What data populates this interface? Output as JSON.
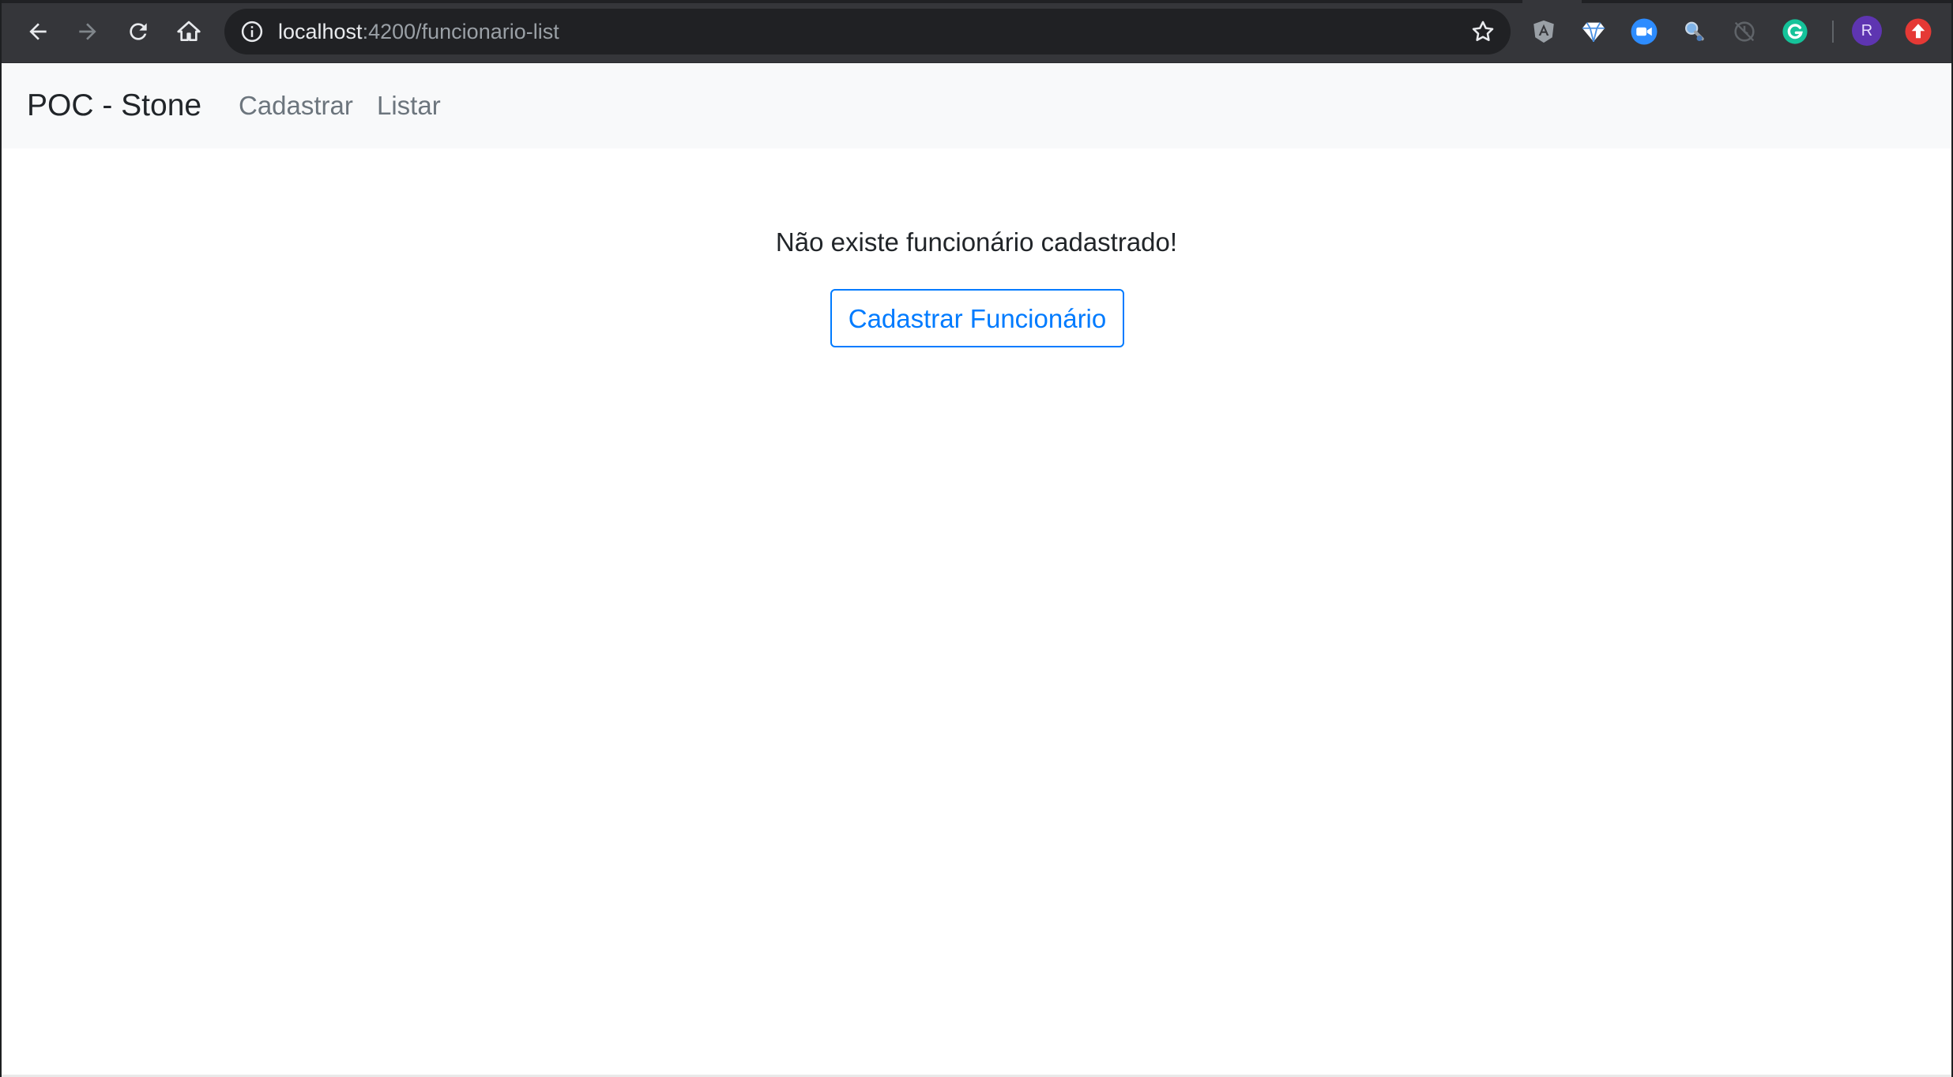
{
  "browser": {
    "url_host": "localhost",
    "url_path": ":4200/funcionario-list",
    "profile_initial": "R",
    "icons": {
      "back": "back-arrow-icon",
      "forward": "forward-arrow-icon",
      "reload": "reload-icon",
      "home": "home-icon",
      "info": "info-icon",
      "bookmark": "star-icon",
      "extensions": [
        "angular-extension-icon",
        "diamond-extension-icon",
        "zoom-extension-icon",
        "magnifier-extension-icon",
        "clock-extension-icon",
        "grammarly-extension-icon",
        "update-icon"
      ]
    }
  },
  "navbar": {
    "brand": "POC - Stone",
    "links": [
      {
        "label": "Cadastrar"
      },
      {
        "label": "Listar"
      }
    ]
  },
  "main": {
    "empty_message": "Não existe funcionário cadastrado!",
    "register_button_label": "Cadastrar Funcionário"
  },
  "colors": {
    "primary": "#007bff",
    "navbar_bg": "#f8f9fa",
    "chrome_toolbar": "#35363a",
    "omnibox_bg": "#202124",
    "text": "#212529",
    "nav_link": "#6c757d"
  }
}
